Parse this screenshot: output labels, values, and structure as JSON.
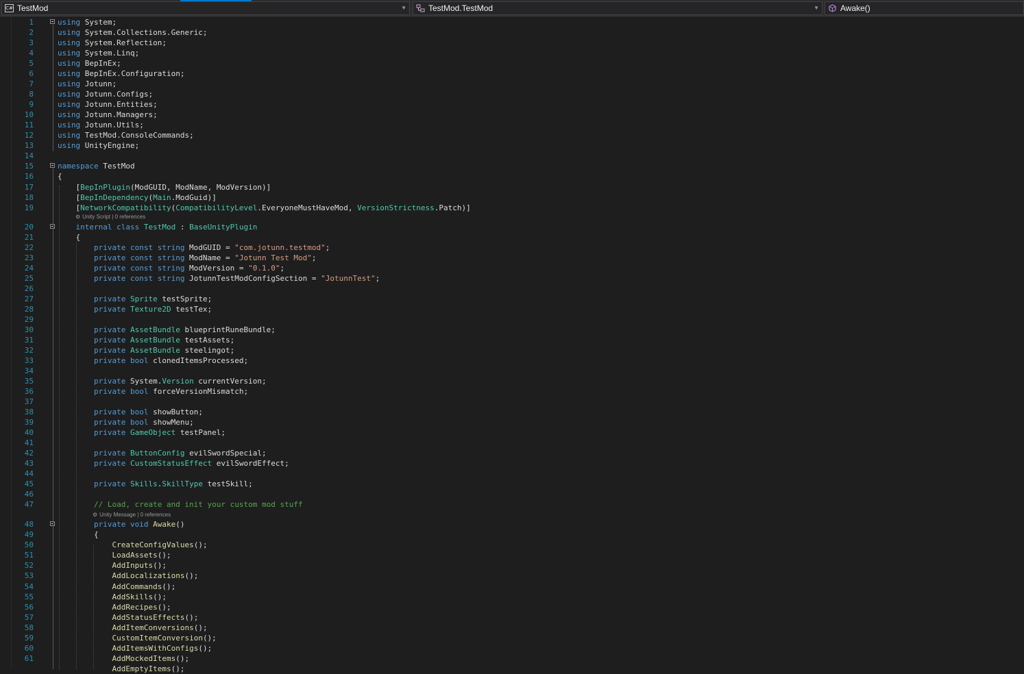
{
  "navbar": {
    "project": "TestMod",
    "type": "TestMod.TestMod",
    "member": "Awake()",
    "project_icon_text": "C#"
  },
  "lens": {
    "class_lens": "Unity Script | 0 references",
    "method_lens": "Unity Message | 0 references"
  },
  "lines": [
    {
      "n": "1",
      "t": [
        [
          "kw",
          "using"
        ],
        [
          "p",
          " System;"
        ]
      ]
    },
    {
      "n": "2",
      "t": [
        [
          "kw",
          "using"
        ],
        [
          "p",
          " System.Collections.Generic;"
        ]
      ]
    },
    {
      "n": "3",
      "t": [
        [
          "kw",
          "using"
        ],
        [
          "p",
          " System.Reflection;"
        ]
      ]
    },
    {
      "n": "4",
      "t": [
        [
          "kw",
          "using"
        ],
        [
          "p",
          " System.Linq;"
        ]
      ]
    },
    {
      "n": "5",
      "t": [
        [
          "kw",
          "using"
        ],
        [
          "p",
          " BepInEx;"
        ]
      ]
    },
    {
      "n": "6",
      "t": [
        [
          "kw",
          "using"
        ],
        [
          "p",
          " BepInEx.Configuration;"
        ]
      ]
    },
    {
      "n": "7",
      "t": [
        [
          "kw",
          "using"
        ],
        [
          "p",
          " Jotunn;"
        ]
      ]
    },
    {
      "n": "8",
      "t": [
        [
          "kw",
          "using"
        ],
        [
          "p",
          " Jotunn.Configs;"
        ]
      ]
    },
    {
      "n": "9",
      "t": [
        [
          "kw",
          "using"
        ],
        [
          "p",
          " Jotunn.Entities;"
        ]
      ]
    },
    {
      "n": "10",
      "t": [
        [
          "kw",
          "using"
        ],
        [
          "p",
          " Jotunn.Managers;"
        ]
      ]
    },
    {
      "n": "11",
      "t": [
        [
          "kw",
          "using"
        ],
        [
          "p",
          " Jotunn.Utils;"
        ]
      ]
    },
    {
      "n": "12",
      "t": [
        [
          "kw",
          "using"
        ],
        [
          "p",
          " TestMod.ConsoleCommands;"
        ]
      ]
    },
    {
      "n": "13",
      "t": [
        [
          "kw",
          "using"
        ],
        [
          "p",
          " UnityEngine;"
        ]
      ]
    },
    {
      "n": "14",
      "t": []
    },
    {
      "n": "15",
      "t": [
        [
          "kw",
          "namespace"
        ],
        [
          "p",
          " TestMod"
        ]
      ]
    },
    {
      "n": "16",
      "t": [
        [
          "p",
          "{"
        ]
      ]
    },
    {
      "n": "17",
      "t": [
        [
          "p",
          "    ["
        ],
        [
          "ty",
          "BepInPlugin"
        ],
        [
          "p",
          "(ModGUID, ModName, ModVersion)]"
        ]
      ]
    },
    {
      "n": "18",
      "t": [
        [
          "p",
          "    ["
        ],
        [
          "ty",
          "BepInDependency"
        ],
        [
          "p",
          "("
        ],
        [
          "ty",
          "Main"
        ],
        [
          "p",
          ".ModGuid)]"
        ]
      ]
    },
    {
      "n": "19",
      "t": [
        [
          "p",
          "    ["
        ],
        [
          "ty",
          "NetworkCompatibility"
        ],
        [
          "p",
          "("
        ],
        [
          "ty",
          "CompatibilityLevel"
        ],
        [
          "p",
          ".EveryoneMustHaveMod, "
        ],
        [
          "ty",
          "VersionStrictness"
        ],
        [
          "p",
          ".Patch)]"
        ]
      ]
    },
    {
      "n": "20",
      "t": [
        [
          "p",
          "    "
        ],
        [
          "kw",
          "internal class"
        ],
        [
          "p",
          " "
        ],
        [
          "ty",
          "TestMod"
        ],
        [
          "p",
          " : "
        ],
        [
          "ty",
          "BaseUnityPlugin"
        ]
      ]
    },
    {
      "n": "21",
      "t": [
        [
          "p",
          "    {"
        ]
      ]
    },
    {
      "n": "22",
      "t": [
        [
          "p",
          "        "
        ],
        [
          "kw",
          "private const string"
        ],
        [
          "p",
          " ModGUID = "
        ],
        [
          "st",
          "\"com.jotunn.testmod\""
        ],
        [
          "p",
          ";"
        ]
      ]
    },
    {
      "n": "23",
      "t": [
        [
          "p",
          "        "
        ],
        [
          "kw",
          "private const string"
        ],
        [
          "p",
          " ModName = "
        ],
        [
          "st",
          "\"Jotunn Test Mod\""
        ],
        [
          "p",
          ";"
        ]
      ]
    },
    {
      "n": "24",
      "t": [
        [
          "p",
          "        "
        ],
        [
          "kw",
          "private const string"
        ],
        [
          "p",
          " ModVersion = "
        ],
        [
          "st",
          "\"0.1.0\""
        ],
        [
          "p",
          ";"
        ]
      ]
    },
    {
      "n": "25",
      "t": [
        [
          "p",
          "        "
        ],
        [
          "kw",
          "private const string"
        ],
        [
          "p",
          " JotunnTestModConfigSection = "
        ],
        [
          "st",
          "\"JotunnTest\""
        ],
        [
          "p",
          ";"
        ]
      ]
    },
    {
      "n": "26",
      "t": []
    },
    {
      "n": "27",
      "t": [
        [
          "p",
          "        "
        ],
        [
          "kw",
          "private"
        ],
        [
          "p",
          " "
        ],
        [
          "ty",
          "Sprite"
        ],
        [
          "p",
          " testSprite;"
        ]
      ]
    },
    {
      "n": "28",
      "t": [
        [
          "p",
          "        "
        ],
        [
          "kw",
          "private"
        ],
        [
          "p",
          " "
        ],
        [
          "ty",
          "Texture2D"
        ],
        [
          "p",
          " testTex;"
        ]
      ]
    },
    {
      "n": "29",
      "t": []
    },
    {
      "n": "30",
      "t": [
        [
          "p",
          "        "
        ],
        [
          "kw",
          "private"
        ],
        [
          "p",
          " "
        ],
        [
          "ty",
          "AssetBundle"
        ],
        [
          "p",
          " blueprintRuneBundle;"
        ]
      ]
    },
    {
      "n": "31",
      "t": [
        [
          "p",
          "        "
        ],
        [
          "kw",
          "private"
        ],
        [
          "p",
          " "
        ],
        [
          "ty",
          "AssetBundle"
        ],
        [
          "p",
          " testAssets;"
        ]
      ]
    },
    {
      "n": "32",
      "t": [
        [
          "p",
          "        "
        ],
        [
          "kw",
          "private"
        ],
        [
          "p",
          " "
        ],
        [
          "ty",
          "AssetBundle"
        ],
        [
          "p",
          " steelingot;"
        ]
      ]
    },
    {
      "n": "33",
      "t": [
        [
          "p",
          "        "
        ],
        [
          "kw",
          "private bool"
        ],
        [
          "p",
          " clonedItemsProcessed;"
        ]
      ]
    },
    {
      "n": "34",
      "t": []
    },
    {
      "n": "35",
      "t": [
        [
          "p",
          "        "
        ],
        [
          "kw",
          "private"
        ],
        [
          "p",
          " System."
        ],
        [
          "ty",
          "Version"
        ],
        [
          "p",
          " currentVersion;"
        ]
      ]
    },
    {
      "n": "36",
      "t": [
        [
          "p",
          "        "
        ],
        [
          "kw",
          "private bool"
        ],
        [
          "p",
          " forceVersionMismatch;"
        ]
      ]
    },
    {
      "n": "37",
      "t": []
    },
    {
      "n": "38",
      "t": [
        [
          "p",
          "        "
        ],
        [
          "kw",
          "private bool"
        ],
        [
          "p",
          " showButton;"
        ]
      ]
    },
    {
      "n": "39",
      "t": [
        [
          "p",
          "        "
        ],
        [
          "kw",
          "private bool"
        ],
        [
          "p",
          " showMenu;"
        ]
      ]
    },
    {
      "n": "40",
      "t": [
        [
          "p",
          "        "
        ],
        [
          "kw",
          "private"
        ],
        [
          "p",
          " "
        ],
        [
          "ty",
          "GameObject"
        ],
        [
          "p",
          " testPanel;"
        ]
      ]
    },
    {
      "n": "41",
      "t": []
    },
    {
      "n": "42",
      "t": [
        [
          "p",
          "        "
        ],
        [
          "kw",
          "private"
        ],
        [
          "p",
          " "
        ],
        [
          "ty",
          "ButtonConfig"
        ],
        [
          "p",
          " evilSwordSpecial;"
        ]
      ]
    },
    {
      "n": "43",
      "t": [
        [
          "p",
          "        "
        ],
        [
          "kw",
          "private"
        ],
        [
          "p",
          " "
        ],
        [
          "ty",
          "CustomStatusEffect"
        ],
        [
          "p",
          " evilSwordEffect;"
        ]
      ]
    },
    {
      "n": "44",
      "t": []
    },
    {
      "n": "45",
      "t": [
        [
          "p",
          "        "
        ],
        [
          "kw",
          "private"
        ],
        [
          "p",
          " "
        ],
        [
          "ty",
          "Skills"
        ],
        [
          "p",
          "."
        ],
        [
          "ty",
          "SkillType"
        ],
        [
          "p",
          " testSkill;"
        ]
      ]
    },
    {
      "n": "46",
      "t": []
    },
    {
      "n": "47",
      "t": [
        [
          "p",
          "        "
        ],
        [
          "cm",
          "// Load, create and init your custom mod stuff"
        ]
      ]
    },
    {
      "n": "48",
      "t": [
        [
          "p",
          "        "
        ],
        [
          "kw",
          "private void"
        ],
        [
          "p",
          " "
        ],
        [
          "fn",
          "Awake"
        ],
        [
          "p",
          "()"
        ]
      ]
    },
    {
      "n": "49",
      "t": [
        [
          "p",
          "        {"
        ]
      ]
    },
    {
      "n": "50",
      "t": [
        [
          "p",
          "            "
        ],
        [
          "fn",
          "CreateConfigValues"
        ],
        [
          "p",
          "();"
        ]
      ]
    },
    {
      "n": "51",
      "t": [
        [
          "p",
          "            "
        ],
        [
          "fn",
          "LoadAssets"
        ],
        [
          "p",
          "();"
        ]
      ]
    },
    {
      "n": "52",
      "t": [
        [
          "p",
          "            "
        ],
        [
          "fn",
          "AddInputs"
        ],
        [
          "p",
          "();"
        ]
      ]
    },
    {
      "n": "53",
      "t": [
        [
          "p",
          "            "
        ],
        [
          "fn",
          "AddLocalizations"
        ],
        [
          "p",
          "();"
        ]
      ]
    },
    {
      "n": "54",
      "t": [
        [
          "p",
          "            "
        ],
        [
          "fn",
          "AddCommands"
        ],
        [
          "p",
          "();"
        ]
      ]
    },
    {
      "n": "55",
      "t": [
        [
          "p",
          "            "
        ],
        [
          "fn",
          "AddSkills"
        ],
        [
          "p",
          "();"
        ]
      ]
    },
    {
      "n": "56",
      "t": [
        [
          "p",
          "            "
        ],
        [
          "fn",
          "AddRecipes"
        ],
        [
          "p",
          "();"
        ]
      ]
    },
    {
      "n": "57",
      "t": [
        [
          "p",
          "            "
        ],
        [
          "fn",
          "AddStatusEffects"
        ],
        [
          "p",
          "();"
        ]
      ]
    },
    {
      "n": "58",
      "t": [
        [
          "p",
          "            "
        ],
        [
          "fn",
          "AddItemConversions"
        ],
        [
          "p",
          "();"
        ]
      ]
    },
    {
      "n": "59",
      "t": [
        [
          "p",
          "            "
        ],
        [
          "fn",
          "CustomItemConversion"
        ],
        [
          "p",
          "();"
        ]
      ]
    },
    {
      "n": "60",
      "t": [
        [
          "p",
          "            "
        ],
        [
          "fn",
          "AddItemsWithConfigs"
        ],
        [
          "p",
          "();"
        ]
      ]
    },
    {
      "n": "61",
      "t": [
        [
          "p",
          "            "
        ],
        [
          "fn",
          "AddMockedItems"
        ],
        [
          "p",
          "();"
        ]
      ]
    },
    {
      "n": "",
      "t": [
        [
          "p",
          "            "
        ],
        [
          "fn",
          "AddEmptyItems"
        ],
        [
          "p",
          "();"
        ]
      ]
    }
  ]
}
